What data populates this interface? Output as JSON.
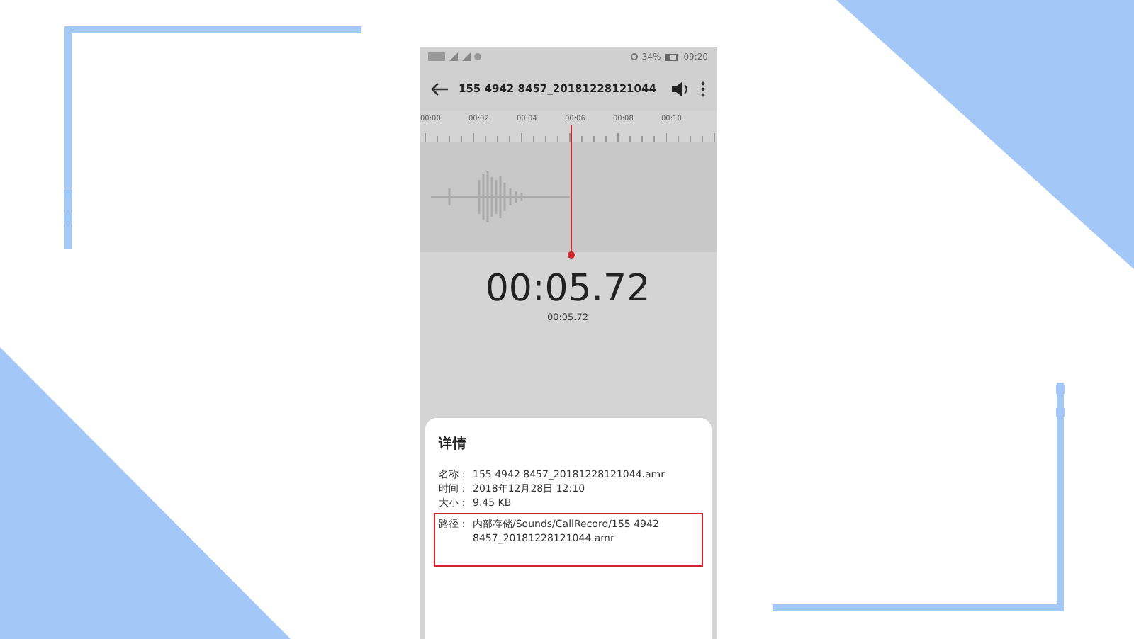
{
  "status_bar": {
    "battery": "34%",
    "time": "09:20"
  },
  "toolbar": {
    "title": "155 4942 8457_20181228121044"
  },
  "timeline": {
    "labels": [
      "00:00",
      "00:02",
      "00:04",
      "00:06",
      "00:08",
      "00:10"
    ]
  },
  "playback": {
    "time": "00:05.72",
    "sub_time": "00:05.72"
  },
  "details": {
    "title": "详情",
    "rows": [
      {
        "label": "名称：",
        "value": "155 4942 8457_20181228121044.amr",
        "highlighted": false
      },
      {
        "label": "时间：",
        "value": "2018年12月28日 12:10",
        "highlighted": false
      },
      {
        "label": "大小：",
        "value": "9.45 KB",
        "highlighted": false
      },
      {
        "label": "路径：",
        "value": "内部存储/Sounds/CallRecord/155 4942 8457_20181228121044.amr",
        "highlighted": true
      }
    ]
  }
}
